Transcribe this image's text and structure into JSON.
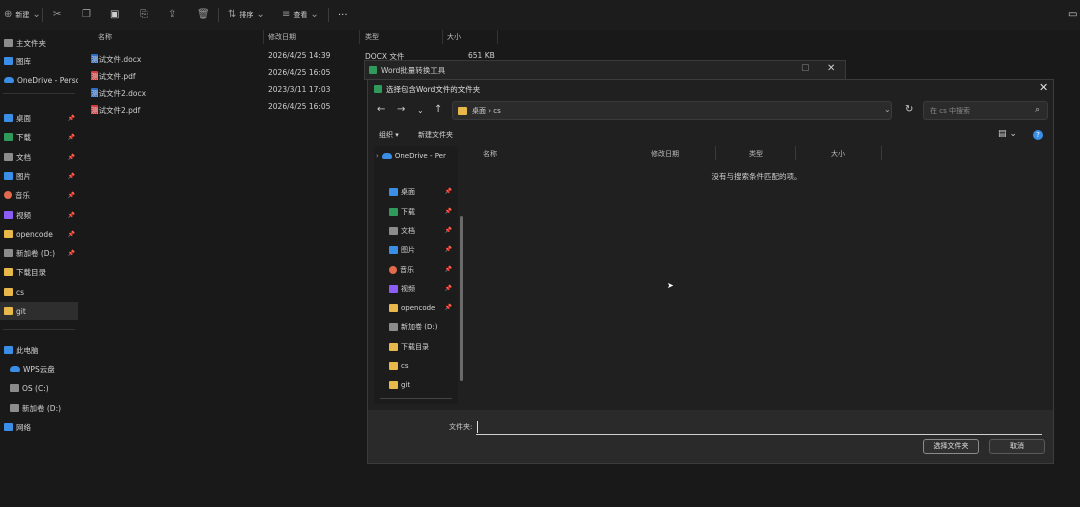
{
  "toolbar": {
    "new_label": "新建",
    "sort_label": "排序",
    "view_label": "查看",
    "more_label": "···"
  },
  "sidebar": {
    "items": [
      {
        "label": "主文件夹"
      },
      {
        "label": "图库"
      },
      {
        "label": "OneDrive - Person"
      },
      {
        "label": "桌面"
      },
      {
        "label": "下载"
      },
      {
        "label": "文档"
      },
      {
        "label": "图片"
      },
      {
        "label": "音乐"
      },
      {
        "label": "视频"
      },
      {
        "label": "opencode"
      },
      {
        "label": "新加卷 (D:)"
      },
      {
        "label": "下载目录"
      },
      {
        "label": "cs"
      },
      {
        "label": "git"
      },
      {
        "label": "此电脑"
      },
      {
        "label": "WPS云盘"
      },
      {
        "label": "OS (C:)"
      },
      {
        "label": "新加卷 (D:)"
      },
      {
        "label": "网络"
      }
    ]
  },
  "filelist": {
    "columns": [
      "名称",
      "修改日期",
      "类型",
      "大小"
    ],
    "rows": [
      {
        "name": "测试文件.docx",
        "date": "2026/4/25 14:39",
        "type": "DOCX 文件",
        "size": "651 KB"
      },
      {
        "name": "测试文件.pdf",
        "date": "2026/4/25 16:05",
        "type": "",
        "size": ""
      },
      {
        "name": "测试文件2.docx",
        "date": "2023/3/11 17:03",
        "type": "",
        "size": ""
      },
      {
        "name": "测试文件2.pdf",
        "date": "2026/4/25 16:05",
        "type": "",
        "size": ""
      }
    ]
  },
  "bg_window": {
    "title": "Word批量转换工具"
  },
  "dialog": {
    "title": "选择包含Word文件的文件夹",
    "breadcrumb": "桌面 › cs",
    "search_placeholder": "在 cs 中搜索",
    "cmd_organize": "组织 ▾",
    "cmd_new_folder": "新建文件夹",
    "nav_items": [
      {
        "label": "OneDrive - Per"
      },
      {
        "label": "桌面"
      },
      {
        "label": "下载"
      },
      {
        "label": "文档"
      },
      {
        "label": "图片"
      },
      {
        "label": "音乐"
      },
      {
        "label": "视频"
      },
      {
        "label": "opencode"
      },
      {
        "label": "新加卷 (D:)"
      },
      {
        "label": "下载目录"
      },
      {
        "label": "cs"
      },
      {
        "label": "git"
      }
    ],
    "columns": [
      "名称",
      "修改日期",
      "类型",
      "大小"
    ],
    "empty_message": "没有与搜索条件匹配的项。",
    "folder_label": "文件夹:",
    "folder_value": "",
    "select_button": "选择文件夹",
    "cancel_button": "取消"
  }
}
